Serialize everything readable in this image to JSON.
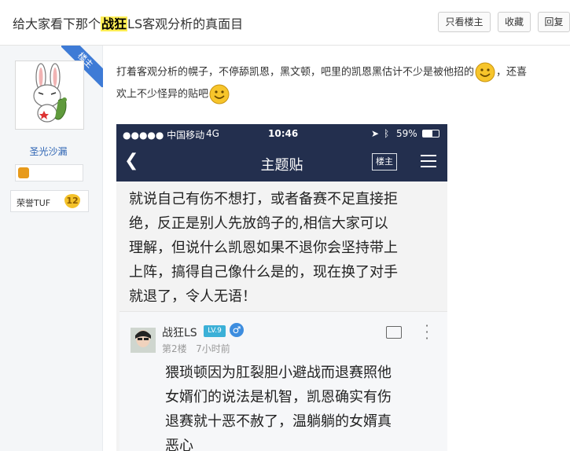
{
  "header": {
    "title_pre": "给大家看下那个",
    "title_highlight": "战狂",
    "title_post": "LS客观分析的真面目",
    "buttons": [
      "只看楼主",
      "收藏",
      "回复"
    ]
  },
  "author": {
    "badge": "楼主",
    "name": "圣光沙漏",
    "honor_label": "荣誉TUF",
    "honor_level": "12"
  },
  "post": {
    "line1": "打着客观分析的幌子，不停舔凯恩，黑文顿，吧里的凯恩黑估计不少是被他招的",
    "line1_tail": "，还喜",
    "line2": "欢上不少怪异的贴吧"
  },
  "screenshot": {
    "carrier": "●●●●● 中国移动",
    "network": "4G",
    "time": "10:46",
    "battery": "59%",
    "title": "主题贴",
    "owner_btn": "楼主",
    "body_lines": [
      "就说自己有伤不想打，或者备赛不足直接拒",
      "绝，反正是别人先放鸽子的,相信大家可以",
      "理解，但说什么凯恩如果不退你会坚持带上",
      "上阵，搞得自己像什么是的，现在换了对手",
      "就退了，令人无语！"
    ],
    "reply": {
      "name": "战狂LS",
      "level": "LV.9",
      "floor": "第2楼",
      "time": "7小时前",
      "lines": [
        "猥琐顿因为肛裂胆小避战而退赛照他",
        "女婿们的说法是机智，凯恩确实有伤",
        "退赛就十恶不赦了，温躺躺的女婿真",
        "恶心"
      ]
    }
  }
}
